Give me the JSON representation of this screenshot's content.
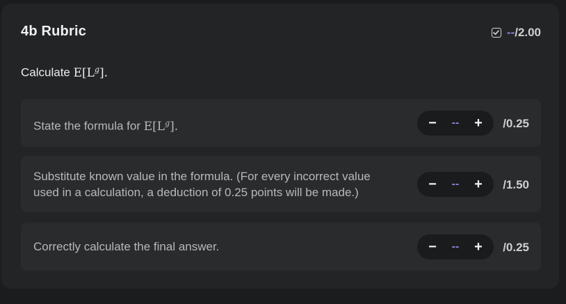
{
  "rubric": {
    "title": "4b Rubric",
    "total_score": "--",
    "total_max": "/2.00",
    "question_prefix": "Calculate ",
    "question_math": "E[L",
    "question_sup": "g",
    "question_suffix": "].",
    "items": [
      {
        "text_prefix": "State the formula for ",
        "math": "E[L",
        "sup": "g",
        "text_suffix": "].",
        "score": "--",
        "minus_label": "−",
        "plus_label": "+",
        "max": "/0.25"
      },
      {
        "text": "Substitute known value in the formula. (For every incorrect value used in a calculation, a deduction of 0.25 points will be made.)",
        "score": "--",
        "minus_label": "−",
        "plus_label": "+",
        "max": "/1.50"
      },
      {
        "text": "Correctly calculate the final answer.",
        "score": "--",
        "minus_label": "−",
        "plus_label": "+",
        "max": "/0.25"
      }
    ]
  },
  "colors": {
    "background": "#1b1c1e",
    "card": "#232426",
    "item": "#2a2b2d",
    "accent": "#8b86d8"
  }
}
